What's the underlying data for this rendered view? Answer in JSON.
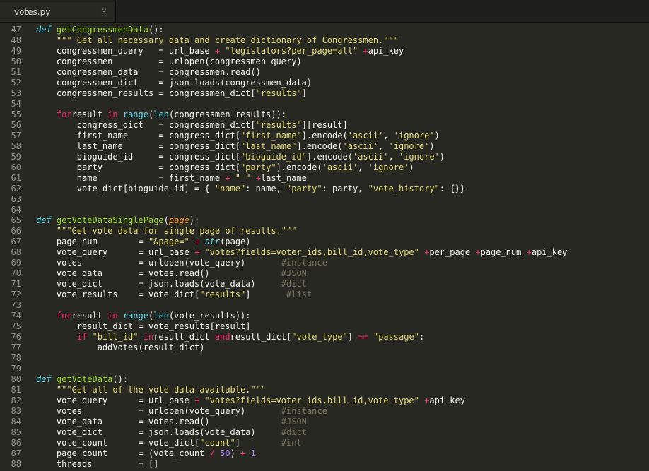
{
  "tab": {
    "title": "votes.py",
    "close_glyph": "×"
  },
  "lines": [
    {
      "n": "47",
      "t": [
        [
          "d",
          "def"
        ],
        [
          "",
          ""
        ],
        [
          "f",
          "getCongressmenData"
        ],
        [
          "",
          "():"
        ]
      ]
    },
    {
      "n": "48",
      "t": [
        [
          "",
          "    "
        ],
        [
          "s",
          "\"\"\" Get all necessary data and create dictionary of Congressmen.\"\"\""
        ]
      ]
    },
    {
      "n": "49",
      "t": [
        [
          "",
          "    congressmen_query   = url_base "
        ],
        [
          "k",
          "+"
        ],
        [
          "",
          ""
        ],
        [
          "s",
          "\"legislators?per_page=all\""
        ],
        [
          "",
          ""
        ],
        [
          "k",
          "+"
        ],
        [
          "",
          "api_key"
        ]
      ]
    },
    {
      "n": "50",
      "t": [
        [
          "",
          "    congressmen         = urlopen(congressmen_query)"
        ]
      ]
    },
    {
      "n": "51",
      "t": [
        [
          "",
          "    congressmen_data    = congressmen.read()"
        ]
      ]
    },
    {
      "n": "52",
      "t": [
        [
          "",
          "    congressmen_dict    = json.loads(congressmen_data)"
        ]
      ]
    },
    {
      "n": "53",
      "t": [
        [
          "",
          "    congressmen_results = congressmen_dict["
        ],
        [
          "s",
          "\"results\""
        ],
        [
          "",
          "]"
        ]
      ]
    },
    {
      "n": "54",
      "t": []
    },
    {
      "n": "55",
      "t": [
        [
          "",
          "    "
        ],
        [
          "k",
          "for"
        ],
        [
          "",
          "result "
        ],
        [
          "k",
          "in"
        ],
        [
          "",
          ""
        ],
        [
          "b",
          "range"
        ],
        [
          "",
          "("
        ],
        [
          "b",
          "len"
        ],
        [
          "",
          "(congressmen_results)):"
        ]
      ]
    },
    {
      "n": "56",
      "t": [
        [
          "",
          "        congress_dict   = congressmen_dict["
        ],
        [
          "s",
          "\"results\""
        ],
        [
          "",
          "][result]"
        ]
      ]
    },
    {
      "n": "57",
      "t": [
        [
          "",
          "        first_name      = congress_dict["
        ],
        [
          "s",
          "\"first_name\""
        ],
        [
          "",
          "].encode("
        ],
        [
          "s",
          "'ascii'"
        ],
        [
          "",
          ", "
        ],
        [
          "s",
          "'ignore'"
        ],
        [
          "",
          ")"
        ]
      ]
    },
    {
      "n": "58",
      "t": [
        [
          "",
          "        last_name       = congress_dict["
        ],
        [
          "s",
          "\"last_name\""
        ],
        [
          "",
          "].encode("
        ],
        [
          "s",
          "'ascii'"
        ],
        [
          "",
          ", "
        ],
        [
          "s",
          "'ignore'"
        ],
        [
          "",
          ")"
        ]
      ]
    },
    {
      "n": "59",
      "t": [
        [
          "",
          "        bioguide_id     = congress_dict["
        ],
        [
          "s",
          "\"bioguide_id\""
        ],
        [
          "",
          "].encode("
        ],
        [
          "s",
          "'ascii'"
        ],
        [
          "",
          ", "
        ],
        [
          "s",
          "'ignore'"
        ],
        [
          "",
          ")"
        ]
      ]
    },
    {
      "n": "60",
      "t": [
        [
          "",
          "        party           = congress_dict["
        ],
        [
          "s",
          "\"party\""
        ],
        [
          "",
          "].encode("
        ],
        [
          "s",
          "'ascii'"
        ],
        [
          "",
          ", "
        ],
        [
          "s",
          "'ignore'"
        ],
        [
          "",
          ")"
        ]
      ]
    },
    {
      "n": "61",
      "t": [
        [
          "",
          "        name            = first_name "
        ],
        [
          "k",
          "+"
        ],
        [
          "",
          ""
        ],
        [
          "s",
          "\" \""
        ],
        [
          "",
          ""
        ],
        [
          "k",
          "+"
        ],
        [
          "",
          "last_name"
        ]
      ]
    },
    {
      "n": "62",
      "t": [
        [
          "",
          "        vote_dict[bioguide_id] = {"
        ],
        [
          "s",
          "\"name\""
        ],
        [
          "",
          ": name, "
        ],
        [
          "s",
          "\"party\""
        ],
        [
          "",
          ": party, "
        ],
        [
          "s",
          "\"vote_history\""
        ],
        [
          "",
          ": {}}"
        ]
      ]
    },
    {
      "n": "63",
      "t": []
    },
    {
      "n": "64",
      "t": []
    },
    {
      "n": "65",
      "t": [
        [
          "d",
          "def"
        ],
        [
          "",
          ""
        ],
        [
          "f",
          "getVoteDataSinglePage"
        ],
        [
          "",
          "("
        ],
        [
          "p",
          "page"
        ],
        [
          "",
          "):"
        ]
      ]
    },
    {
      "n": "66",
      "t": [
        [
          "",
          "    "
        ],
        [
          "s",
          "\"\"\"Get vote data for single page of results.\"\"\""
        ]
      ]
    },
    {
      "n": "67",
      "t": [
        [
          "",
          "    page_num        = "
        ],
        [
          "s",
          "\"&page=\""
        ],
        [
          "",
          ""
        ],
        [
          "k",
          "+"
        ],
        [
          "",
          ""
        ],
        [
          "d",
          "str"
        ],
        [
          "",
          "(page)"
        ]
      ]
    },
    {
      "n": "68",
      "t": [
        [
          "",
          "    vote_query      = url_base "
        ],
        [
          "k",
          "+"
        ],
        [
          "",
          ""
        ],
        [
          "s",
          "\"votes?fields=voter_ids,bill_id,vote_type\""
        ],
        [
          "",
          ""
        ],
        [
          "k",
          "+"
        ],
        [
          "",
          "per_page "
        ],
        [
          "k",
          "+"
        ],
        [
          "",
          "page_num "
        ],
        [
          "k",
          "+"
        ],
        [
          "",
          "api_key"
        ]
      ]
    },
    {
      "n": "69",
      "t": [
        [
          "",
          "    votes           = urlopen(vote_query)       "
        ],
        [
          "c",
          "#instance"
        ]
      ]
    },
    {
      "n": "70",
      "t": [
        [
          "",
          "    vote_data       = votes.read()              "
        ],
        [
          "c",
          "#JSON"
        ]
      ]
    },
    {
      "n": "71",
      "t": [
        [
          "",
          "    vote_dict       = json.loads(vote_data)     "
        ],
        [
          "c",
          "#dict"
        ]
      ]
    },
    {
      "n": "72",
      "t": [
        [
          "",
          "    vote_results    = vote_dict["
        ],
        [
          "s",
          "\"results\""
        ],
        [
          "",
          "]       "
        ],
        [
          "c",
          "#list"
        ]
      ]
    },
    {
      "n": "73",
      "t": []
    },
    {
      "n": "74",
      "t": [
        [
          "",
          "    "
        ],
        [
          "k",
          "for"
        ],
        [
          "",
          "result "
        ],
        [
          "k",
          "in"
        ],
        [
          "",
          ""
        ],
        [
          "b",
          "range"
        ],
        [
          "",
          "("
        ],
        [
          "b",
          "len"
        ],
        [
          "",
          "(vote_results)):"
        ]
      ]
    },
    {
      "n": "75",
      "t": [
        [
          "",
          "        result_dict = vote_results[result]"
        ]
      ]
    },
    {
      "n": "76",
      "t": [
        [
          "",
          "        "
        ],
        [
          "k",
          "if"
        ],
        [
          "",
          ""
        ],
        [
          "s",
          "\"bill_id\""
        ],
        [
          "",
          ""
        ],
        [
          "k",
          "in"
        ],
        [
          "",
          "result_dict "
        ],
        [
          "k",
          "and"
        ],
        [
          "",
          "result_dict["
        ],
        [
          "s",
          "\"vote_type\""
        ],
        [
          "",
          "] "
        ],
        [
          "k",
          "=="
        ],
        [
          "",
          ""
        ],
        [
          "s",
          "\"passage\""
        ],
        [
          "",
          ":"
        ]
      ]
    },
    {
      "n": "77",
      "t": [
        [
          "",
          "            addVotes(result_dict)"
        ]
      ]
    },
    {
      "n": "78",
      "t": []
    },
    {
      "n": "79",
      "t": []
    },
    {
      "n": "80",
      "t": [
        [
          "d",
          "def"
        ],
        [
          "",
          ""
        ],
        [
          "f",
          "getVoteData"
        ],
        [
          "",
          "():"
        ]
      ]
    },
    {
      "n": "81",
      "t": [
        [
          "",
          "    "
        ],
        [
          "s",
          "\"\"\"Get all of the vote data available.\"\"\""
        ]
      ]
    },
    {
      "n": "82",
      "t": [
        [
          "",
          "    vote_query      = url_base "
        ],
        [
          "k",
          "+"
        ],
        [
          "",
          ""
        ],
        [
          "s",
          "\"votes?fields=voter_ids,bill_id,vote_type\""
        ],
        [
          "",
          ""
        ],
        [
          "k",
          "+"
        ],
        [
          "",
          "api_key"
        ]
      ]
    },
    {
      "n": "83",
      "t": [
        [
          "",
          "    votes           = urlopen(vote_query)       "
        ],
        [
          "c",
          "#instance"
        ]
      ]
    },
    {
      "n": "84",
      "t": [
        [
          "",
          "    vote_data       = votes.read()              "
        ],
        [
          "c",
          "#JSON"
        ]
      ]
    },
    {
      "n": "85",
      "t": [
        [
          "",
          "    vote_dict       = json.loads(vote_data)     "
        ],
        [
          "c",
          "#dict"
        ]
      ]
    },
    {
      "n": "86",
      "t": [
        [
          "",
          "    vote_count      = vote_dict["
        ],
        [
          "s",
          "\"count\""
        ],
        [
          "",
          "]        "
        ],
        [
          "c",
          "#int"
        ]
      ]
    },
    {
      "n": "87",
      "t": [
        [
          "",
          "    page_count      = (vote_count"
        ],
        [
          "k",
          "/"
        ],
        [
          "n",
          "50"
        ],
        [
          "",
          ") "
        ],
        [
          "k",
          "+"
        ],
        [
          "",
          ""
        ],
        [
          "n",
          "1"
        ]
      ]
    },
    {
      "n": "88",
      "t": [
        [
          "",
          "    threads         = []"
        ]
      ]
    }
  ]
}
